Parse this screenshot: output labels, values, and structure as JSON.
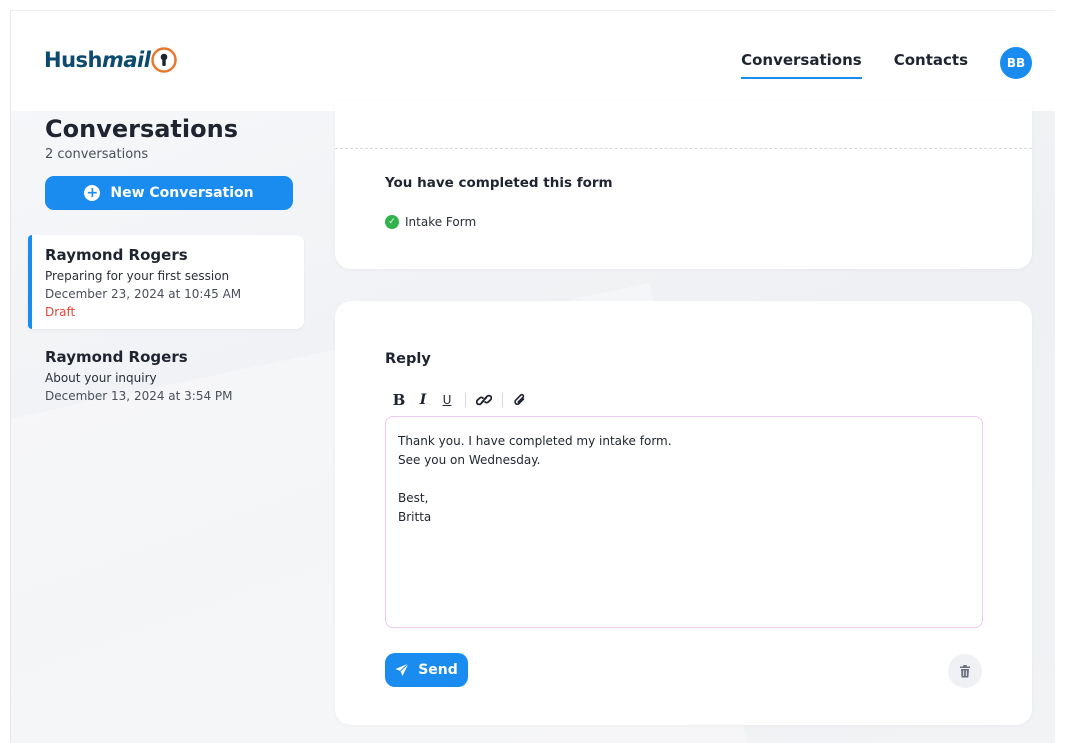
{
  "header": {
    "logo_part1": "Hush",
    "logo_part2": "mail",
    "nav": [
      {
        "label": "Conversations",
        "active": true
      },
      {
        "label": "Contacts",
        "active": false
      }
    ],
    "avatar_initials": "BB"
  },
  "sidebar": {
    "title": "Conversations",
    "count": "2 conversations",
    "new_button": "New Conversation",
    "conversations": [
      {
        "name": "Raymond Rogers",
        "subject": "Preparing for your first session",
        "date": "December 23, 2024 at 10:45 AM",
        "status": "Draft"
      },
      {
        "name": "Raymond Rogers",
        "subject": "About your inquiry",
        "date": "December 13, 2024 at 3:54 PM",
        "status": ""
      }
    ]
  },
  "form_card": {
    "title": "You have completed this form",
    "item": "Intake Form"
  },
  "reply": {
    "title": "Reply",
    "toolbar": {
      "bold": "B",
      "italic": "I",
      "underline": "U"
    },
    "lines": [
      "Thank you. I have completed my intake form.",
      "See you on Wednesday.",
      "",
      "Best,",
      "Britta"
    ],
    "send_label": "Send"
  },
  "colors": {
    "accent": "#1a8cf0",
    "draft": "#e0453b",
    "success": "#2fb34a",
    "logo": "#0c4a6e",
    "logo_lock": "#e8792e"
  },
  "icons": [
    "lock-icon",
    "plus-icon",
    "check-icon",
    "link-icon",
    "paperclip-icon",
    "send-icon",
    "trash-icon"
  ]
}
